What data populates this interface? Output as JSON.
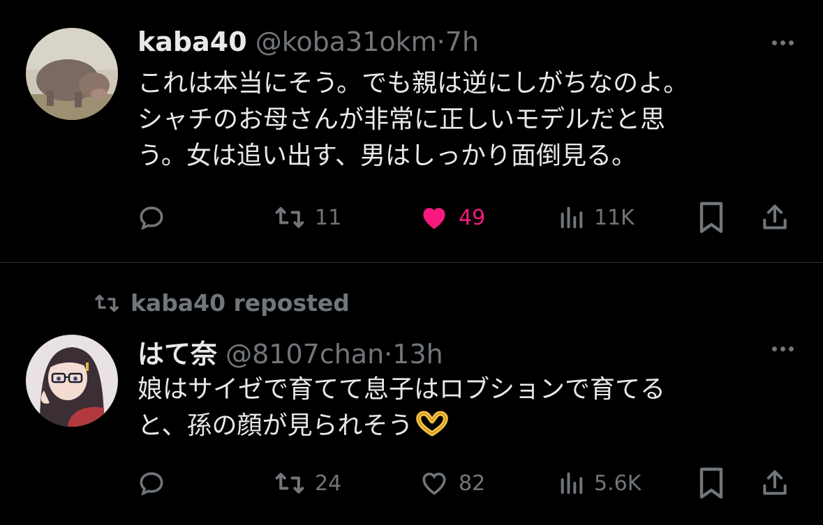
{
  "tweets": [
    {
      "name": "kaba40",
      "handle": "@koba31okm",
      "separator": "·",
      "time": "7h",
      "lines": [
        "これは本当にそう。でも親は逆にしがちなのよ。",
        "シャチのお母さんが非常に正しいモデルだと思",
        "う。女は追い出す、男はしっかり面倒見る。"
      ],
      "reposts": "11",
      "likes": "49",
      "liked": true,
      "views": "11K"
    },
    {
      "reposted_by": "kaba40 reposted",
      "name": "はて奈",
      "handle": "@8107chan",
      "separator": "·",
      "time": "13h",
      "lines": [
        "娘はサイゼで育てて息子はロブションで育てる",
        "と、孫の顔が見られそう"
      ],
      "emoji": "heart-hands-emoji",
      "reposts": "24",
      "likes": "82",
      "liked": false,
      "views": "5.6K"
    }
  ],
  "colors": {
    "background": "#000000",
    "text": "#e7e9ea",
    "muted": "#71767b",
    "like_active": "#f91880",
    "divider": "#2f3336"
  },
  "icons": [
    "reply-icon",
    "retweet-icon",
    "like-icon",
    "views-icon",
    "bookmark-icon",
    "share-icon",
    "more-icon"
  ]
}
